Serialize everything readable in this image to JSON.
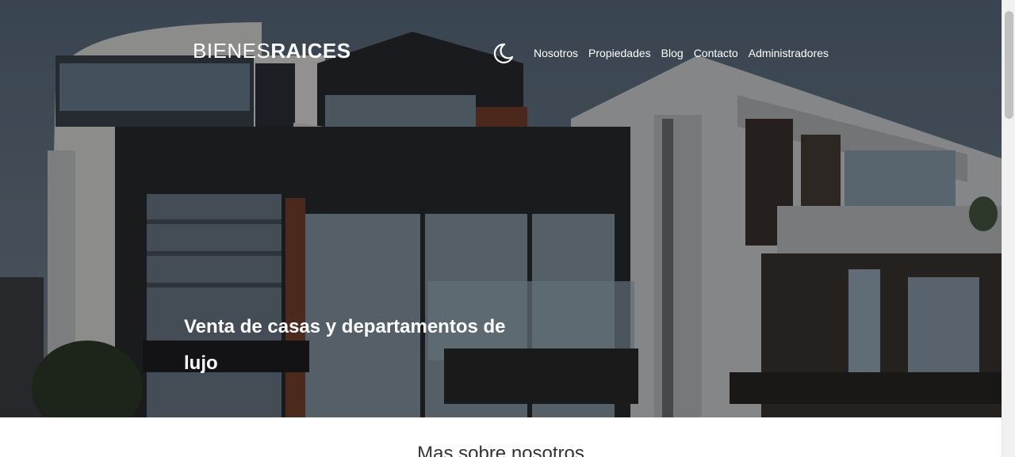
{
  "header": {
    "logo_light": "BIENES",
    "logo_bold": "RAICES",
    "dark_mode_icon": "moon-icon",
    "nav": [
      {
        "label": "Nosotros"
      },
      {
        "label": "Propiedades"
      },
      {
        "label": "Blog"
      },
      {
        "label": "Contacto"
      },
      {
        "label": "Administradores"
      }
    ]
  },
  "hero": {
    "title": "Venta de casas y departamentos de lujo"
  },
  "about": {
    "heading": "Mas sobre nosotros"
  },
  "colors": {
    "text_light": "#ffffff",
    "heading_dark": "#333333"
  }
}
